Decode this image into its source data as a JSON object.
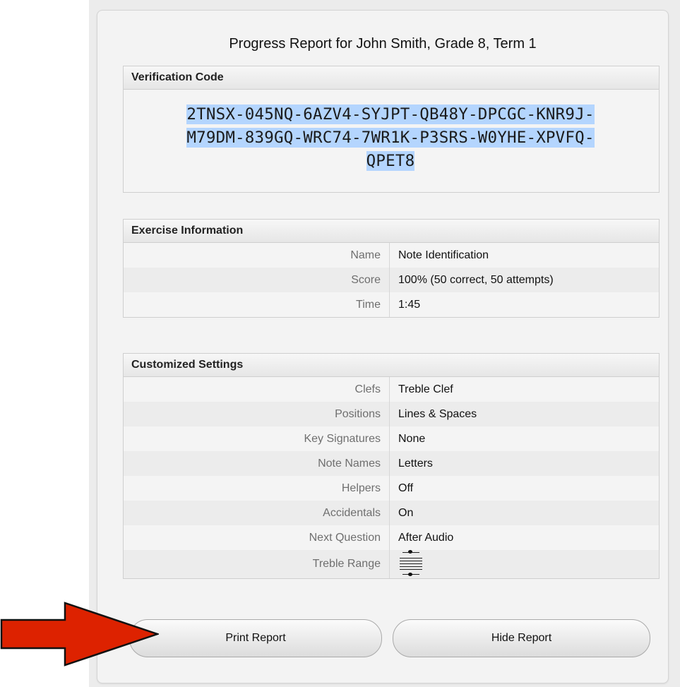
{
  "title": "Progress Report for John Smith, Grade 8, Term 1",
  "verification": {
    "header": "Verification Code",
    "code_lines": [
      "2TNSX-045NQ-6AZV4-SYJPT-QB48Y-DPCGC-KNR9J-",
      "M79DM-839GQ-WRC74-7WR1K-P3SRS-W0YHE-XPVFQ-",
      "QPET8"
    ]
  },
  "exercise": {
    "header": "Exercise Information",
    "rows": [
      {
        "label": "Name",
        "value": "Note Identification"
      },
      {
        "label": "Score",
        "value": "100% (50 correct, 50 attempts)"
      },
      {
        "label": "Time",
        "value": "1:45"
      }
    ]
  },
  "settings": {
    "header": "Customized Settings",
    "rows": [
      {
        "label": "Clefs",
        "value": "Treble Clef"
      },
      {
        "label": "Positions",
        "value": "Lines & Spaces"
      },
      {
        "label": "Key Signatures",
        "value": "None"
      },
      {
        "label": "Note Names",
        "value": "Letters"
      },
      {
        "label": "Helpers",
        "value": "Off"
      },
      {
        "label": "Accidentals",
        "value": "On"
      },
      {
        "label": "Next Question",
        "value": "After Audio"
      },
      {
        "label": "Treble Range",
        "value": ""
      }
    ]
  },
  "buttons": {
    "print": "Print Report",
    "hide": "Hide Report"
  },
  "colors": {
    "selection": "#b4d5fe",
    "arrow": "#dd2200"
  },
  "icons": {
    "treble_range": "staff-range-icon",
    "pointer": "red-arrow-icon"
  }
}
